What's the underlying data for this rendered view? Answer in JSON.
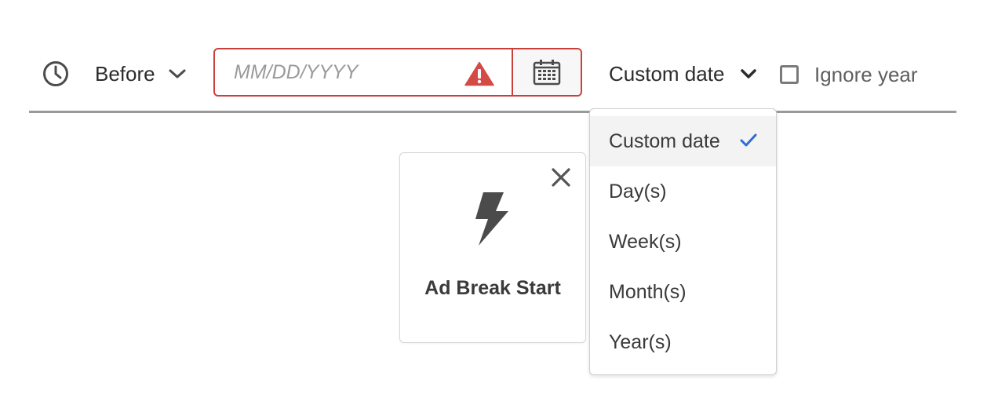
{
  "filter": {
    "operator_label": "Before",
    "date_placeholder": "MM/DD/YYYY",
    "date_value": "",
    "mode_label": "Custom date",
    "ignore_year_label": "Ignore year",
    "ignore_year_checked": false
  },
  "menu": {
    "items": [
      {
        "label": "Custom date",
        "selected": true
      },
      {
        "label": "Day(s)",
        "selected": false
      },
      {
        "label": "Week(s)",
        "selected": false
      },
      {
        "label": "Month(s)",
        "selected": false
      },
      {
        "label": "Year(s)",
        "selected": false
      }
    ]
  },
  "card": {
    "title": "Ad Break Start",
    "icon": "lightning-bolt-icon"
  },
  "icons": {
    "clock": "clock-icon",
    "alert": "alert-triangle-icon",
    "calendar": "calendar-icon",
    "chevron": "chevron-down-icon",
    "close": "close-icon",
    "check": "checkmark-icon"
  },
  "colors": {
    "error": "#c9403b",
    "accent": "#2d6bd8",
    "text": "#2c2c2c",
    "icon": "#4b4b4b"
  }
}
